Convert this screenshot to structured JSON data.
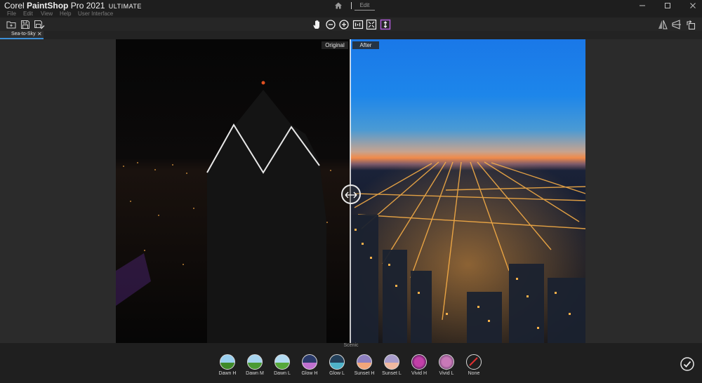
{
  "app": {
    "title_corel": "Corel",
    "title_product": "PaintShop",
    "title_pro": "Pro 2021",
    "title_edition": "ULTIMATE"
  },
  "workspace": {
    "edit_tab": "Edit"
  },
  "menu": {
    "items": [
      "File",
      "Edit",
      "View",
      "Help",
      "User Interface"
    ]
  },
  "document": {
    "tab_label": "Sea-to-Sky"
  },
  "canvas": {
    "original_label": "Original",
    "after_label": "After"
  },
  "presets": {
    "category": "Scenic",
    "items": [
      {
        "label": "Dawn H",
        "icon": "landscape-thumb",
        "color_top": "#9ad0f0",
        "color_bottom": "#3f8a2a"
      },
      {
        "label": "Dawn M",
        "icon": "landscape-thumb",
        "color_top": "#a6d4ef",
        "color_bottom": "#4a9a33"
      },
      {
        "label": "Dawn L",
        "icon": "landscape-thumb",
        "color_top": "#b2dbf2",
        "color_bottom": "#56a83b"
      },
      {
        "label": "Glow H",
        "icon": "glow-thumb",
        "color_top": "#2a3a6a",
        "color_bottom": "#c070d0"
      },
      {
        "label": "Glow L",
        "icon": "glow-thumb",
        "color_top": "#23405a",
        "color_bottom": "#4fb3c9"
      },
      {
        "label": "Sunset H",
        "icon": "sunset-thumb",
        "color_top": "#8d7fbf",
        "color_bottom": "#f2a67a"
      },
      {
        "label": "Sunset L",
        "icon": "sunset-thumb",
        "color_top": "#a89ccb",
        "color_bottom": "#f0b9a0"
      },
      {
        "label": "Vivid H",
        "icon": "flower-thumb",
        "color_top": "#c23fa8",
        "color_bottom": "#5a1b5a"
      },
      {
        "label": "Vivid L",
        "icon": "flower-thumb",
        "color_top": "#c879b8",
        "color_bottom": "#7a4a7a"
      },
      {
        "label": "None",
        "icon": "none-thumb",
        "color_top": "#1f1f1f",
        "color_bottom": "#1f1f1f"
      }
    ]
  },
  "colors": {
    "accent": "#3d8fd6",
    "selected_tool": "#b05ad8",
    "none_slash": "#e23030"
  }
}
